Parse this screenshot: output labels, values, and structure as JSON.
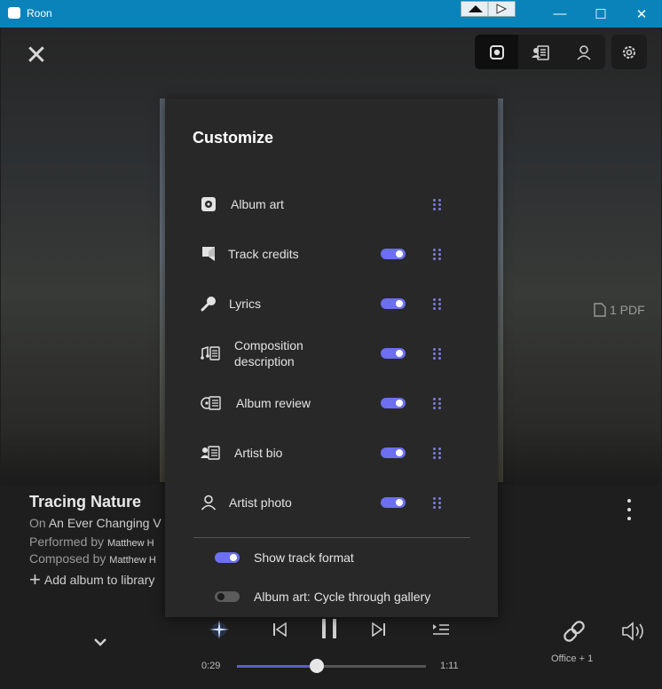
{
  "window": {
    "title": "Roon",
    "minimize_glyph": "—",
    "maximize_glyph": "☐",
    "close_glyph": "✕"
  },
  "header": {
    "close_glyph": "✕",
    "view_tabs": [
      "album-art-view-icon",
      "credits-view-icon",
      "artist-view-icon"
    ],
    "settings_icon": "gear-icon"
  },
  "pdf": {
    "label": "1 PDF",
    "icon": "document-icon"
  },
  "now_playing": {
    "title": "Tracing Nature",
    "on_prefix": "On",
    "album": "An Ever Changing V",
    "performed_prefix": "Performed by",
    "performer": "Matthew H",
    "composed_prefix": "Composed by",
    "composer": "Matthew H",
    "add_to_library": "Add album to library"
  },
  "transport": {
    "elapsed": "0:29",
    "duration": "1:11",
    "progress": 0.41,
    "zone": "Office + 1"
  },
  "customize": {
    "title": "Customize",
    "items": [
      {
        "label": "Album art",
        "icon": "album-art-icon",
        "toggle": null
      },
      {
        "label": "Track credits",
        "icon": "track-credits-icon",
        "toggle": true
      },
      {
        "label": "Lyrics",
        "icon": "microphone-icon",
        "toggle": true
      },
      {
        "label": "Composition description",
        "line1": "Composition",
        "line2": "description",
        "icon": "composition-icon",
        "toggle": true
      },
      {
        "label": "Album review",
        "icon": "album-review-icon",
        "toggle": true
      },
      {
        "label": "Artist bio",
        "icon": "artist-bio-icon",
        "toggle": true
      },
      {
        "label": "Artist photo",
        "icon": "artist-photo-icon",
        "toggle": true
      }
    ],
    "options": [
      {
        "label": "Show track format",
        "enabled": true
      },
      {
        "label": "Album art: Cycle through gallery",
        "enabled": false
      }
    ]
  },
  "colors": {
    "titlebar": "#0a83bb",
    "accent": "#6c6ff0",
    "panel": "#282828",
    "background": "#1e1e1e"
  }
}
